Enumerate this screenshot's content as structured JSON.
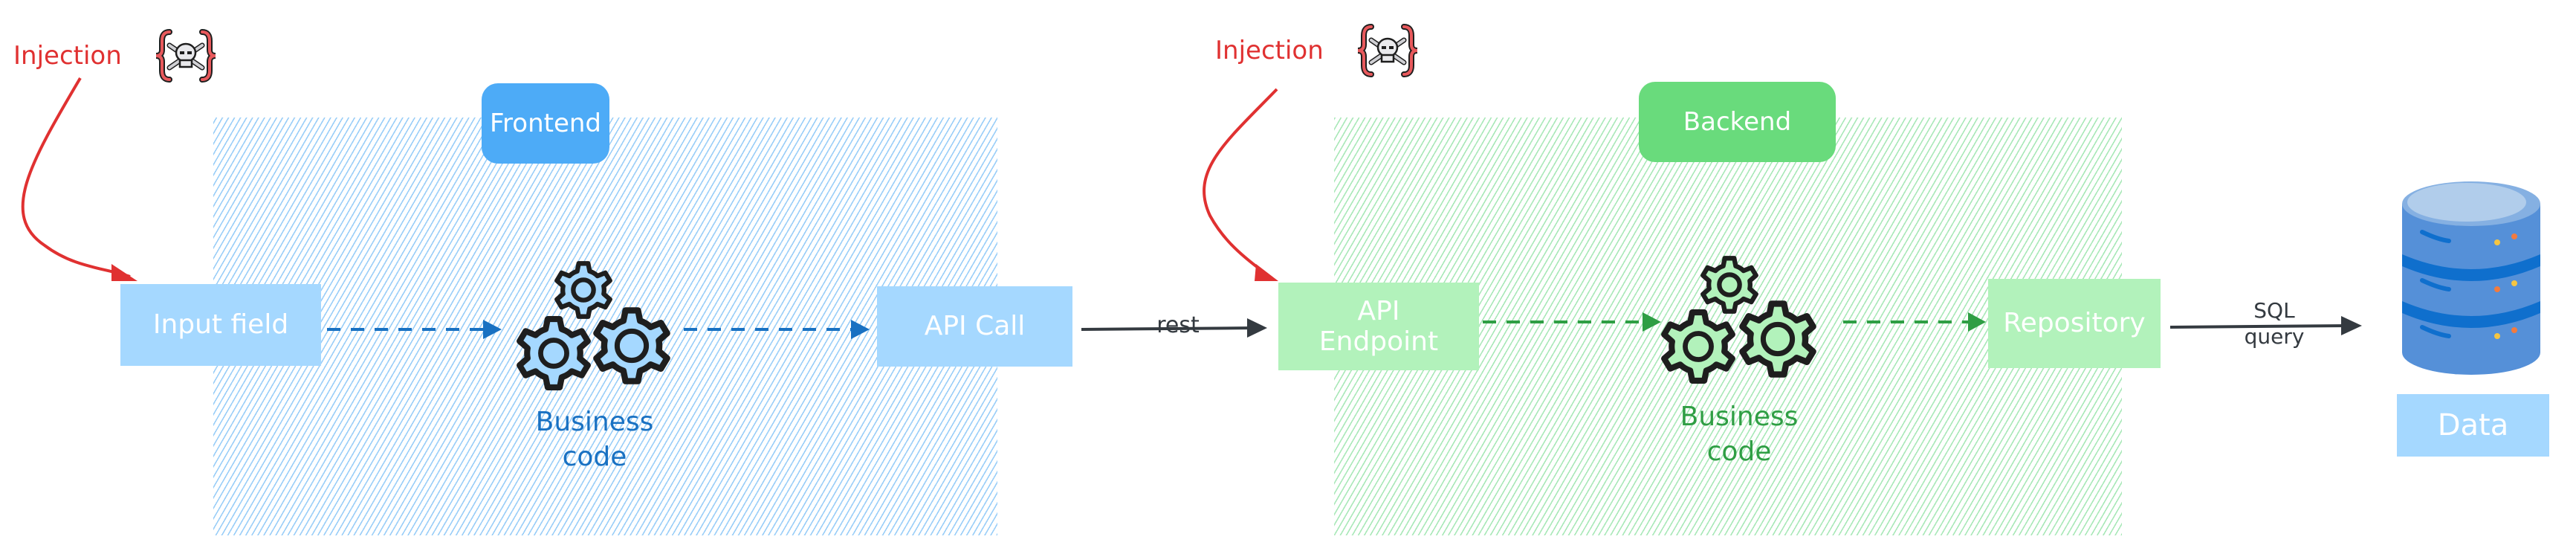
{
  "colors": {
    "frontend_accent": "#4dabf7",
    "frontend_node": "#a5d8ff",
    "frontend_text": "#1971c2",
    "backend_accent": "#69db7c",
    "backend_node": "#b2f2bb",
    "backend_text": "#2f9e44",
    "injection": "#e03131",
    "connector": "#343a40"
  },
  "frontend": {
    "title": "Frontend",
    "input_field": "Input field",
    "business_code_line1": "Business",
    "business_code_line2": "code",
    "api_call": "API Call"
  },
  "backend": {
    "title": "Backend",
    "api_endpoint_line1": "API",
    "api_endpoint_line2": "Endpoint",
    "business_code_line1": "Business",
    "business_code_line2": "code",
    "repository": "Repository"
  },
  "connectors": {
    "rest": "rest",
    "sql_line1": "SQL",
    "sql_line2": "query"
  },
  "injections": [
    {
      "label": "Injection",
      "icon": "skull-crossbones-braces-icon",
      "target": "Input field"
    },
    {
      "label": "Injection",
      "icon": "skull-crossbones-braces-icon",
      "target": "API Endpoint"
    }
  ],
  "data_store": {
    "label": "Data",
    "icon": "database-icon"
  }
}
